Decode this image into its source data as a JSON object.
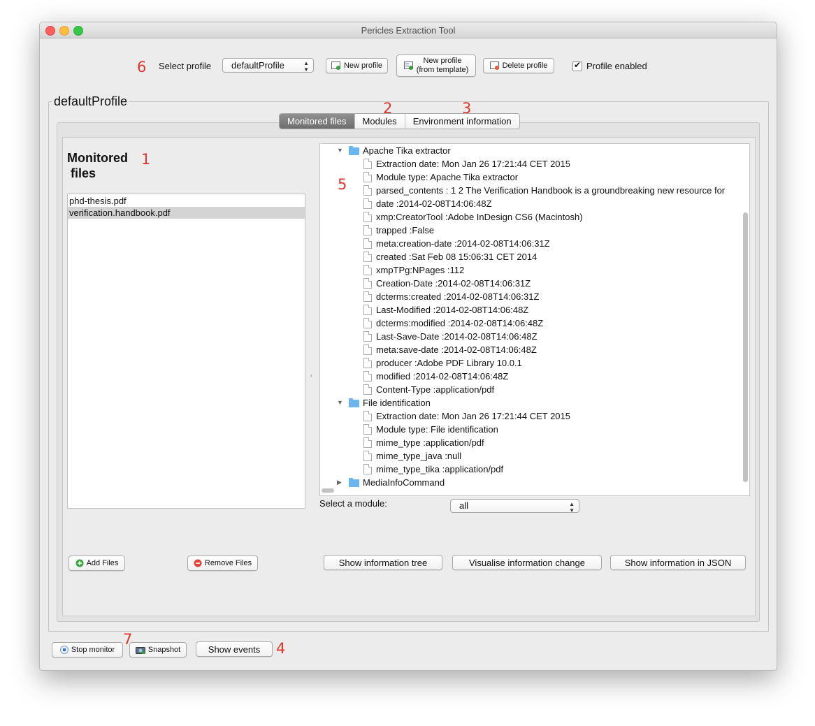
{
  "window": {
    "title": "Pericles Extraction Tool"
  },
  "annotations": {
    "a1": "1",
    "a2": "2",
    "a3": "3",
    "a4": "4",
    "a5": "5",
    "a6": "6",
    "a7": "7"
  },
  "profile_bar": {
    "select_label": "Select profile",
    "selected_profile": "defaultProfile",
    "new_profile": "New profile",
    "new_profile_template_line1": "New profile",
    "new_profile_template_line2": "(from template)",
    "delete_profile": "Delete profile",
    "profile_enabled_label": "Profile enabled",
    "profile_enabled": true
  },
  "profile_group": {
    "title": "defaultProfile"
  },
  "tabs": [
    {
      "label": "Monitored files",
      "active": true
    },
    {
      "label": "Modules",
      "active": false
    },
    {
      "label": "Environment information",
      "active": false
    }
  ],
  "monitored": {
    "heading_line1": "Monitored",
    "heading_line2": "files",
    "files": [
      "phd-thesis.pdf",
      "verification.handbook.pdf"
    ],
    "selected_index": 1,
    "add_files": "Add Files",
    "remove_files": "Remove Files"
  },
  "tree": {
    "nodes": [
      {
        "label": "Apache Tika extractor",
        "type": "folder",
        "expanded": true
      },
      {
        "label": "Extraction date: Mon Jan 26 17:21:44 CET 2015",
        "type": "leaf"
      },
      {
        "label": "Module type: Apache Tika extractor",
        "type": "leaf"
      },
      {
        "label": "parsed_contents : 1     2 The Verification Handbook is a groundbreaking new resource for",
        "type": "leaf"
      },
      {
        "label": "date :2014-02-08T14:06:48Z",
        "type": "leaf"
      },
      {
        "label": "xmp:CreatorTool :Adobe InDesign CS6 (Macintosh)",
        "type": "leaf"
      },
      {
        "label": "trapped :False",
        "type": "leaf"
      },
      {
        "label": "meta:creation-date :2014-02-08T14:06:31Z",
        "type": "leaf"
      },
      {
        "label": "created :Sat Feb 08 15:06:31 CET 2014",
        "type": "leaf"
      },
      {
        "label": "xmpTPg:NPages :112",
        "type": "leaf"
      },
      {
        "label": "Creation-Date :2014-02-08T14:06:31Z",
        "type": "leaf"
      },
      {
        "label": "dcterms:created :2014-02-08T14:06:31Z",
        "type": "leaf"
      },
      {
        "label": "Last-Modified :2014-02-08T14:06:48Z",
        "type": "leaf"
      },
      {
        "label": "dcterms:modified :2014-02-08T14:06:48Z",
        "type": "leaf"
      },
      {
        "label": "Last-Save-Date :2014-02-08T14:06:48Z",
        "type": "leaf"
      },
      {
        "label": "meta:save-date :2014-02-08T14:06:48Z",
        "type": "leaf"
      },
      {
        "label": "producer :Adobe PDF Library 10.0.1",
        "type": "leaf"
      },
      {
        "label": "modified :2014-02-08T14:06:48Z",
        "type": "leaf"
      },
      {
        "label": "Content-Type :application/pdf",
        "type": "leaf"
      },
      {
        "label": "File identification",
        "type": "folder",
        "expanded": true
      },
      {
        "label": "Extraction date: Mon Jan 26 17:21:44 CET 2015",
        "type": "leaf"
      },
      {
        "label": "Module type: File identification",
        "type": "leaf"
      },
      {
        "label": "mime_type :application/pdf",
        "type": "leaf"
      },
      {
        "label": "mime_type_java :null",
        "type": "leaf"
      },
      {
        "label": "mime_type_tika :application/pdf",
        "type": "leaf"
      },
      {
        "label": "MediaInfoCommand",
        "type": "folder",
        "expanded": false
      }
    ]
  },
  "module_select": {
    "label": "Select a module:",
    "value": "all"
  },
  "info_buttons": {
    "tree": "Show information tree",
    "visualise": "Visualise information change",
    "json": "Show information in JSON"
  },
  "bottom_bar": {
    "stop_monitor": "Stop monitor",
    "snapshot": "Snapshot",
    "show_events": "Show events"
  }
}
